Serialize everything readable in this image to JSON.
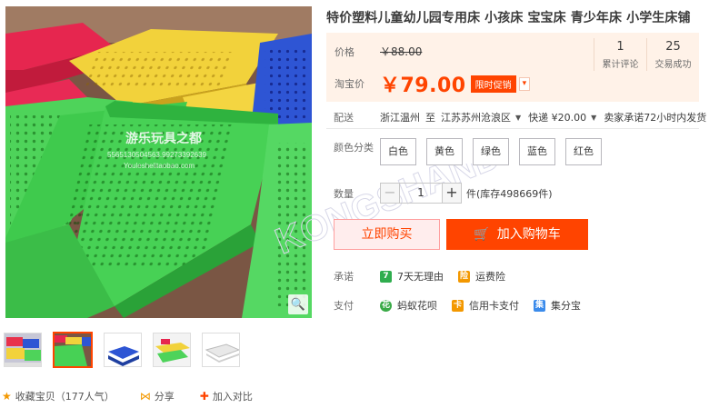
{
  "product": {
    "title": "特价塑料儿童幼儿园专用床 小孩床 宝宝床 青少年床 小学生床铺",
    "watermark_shop": "游乐玩具之都",
    "watermark_line2": "5565130504563.99273392639",
    "watermark_line3": "Youleshelitaobao.com",
    "watermark_brand": "KONGSHANDIS"
  },
  "price": {
    "label": "价格",
    "original": "￥88.00",
    "taobao_label": "淘宝价",
    "current": "￥79.00",
    "promo_tag": "限时促销",
    "promo_arrow": "▾"
  },
  "stats": [
    {
      "num": "1",
      "caption": "累计评论"
    },
    {
      "num": "25",
      "caption": "交易成功"
    }
  ],
  "shipping": {
    "label": "配送",
    "from": "浙江温州",
    "to_word": "至",
    "to": "江苏苏州沧浪区",
    "method": "快递 ¥20.00",
    "promise": "卖家承诺72小时内发货"
  },
  "colors": {
    "label": "颜色分类",
    "options": [
      "白色",
      "黄色",
      "绿色",
      "蓝色",
      "红色"
    ]
  },
  "quantity": {
    "label": "数量",
    "minus": "−",
    "plus": "+",
    "value": "1",
    "stock": "件(库存498669件)"
  },
  "buttons": {
    "buy_now": "立即购买",
    "add_cart": "加入购物车"
  },
  "promise": {
    "label": "承诺",
    "items": [
      {
        "icon": "7",
        "text": "7天无理由",
        "color": "#2fad4e"
      },
      {
        "icon": "险",
        "text": "运费险",
        "color": "#f39800"
      }
    ]
  },
  "payment": {
    "label": "支付",
    "items": [
      {
        "icon": "花",
        "text": "蚂蚁花呗",
        "color": "#3aaa47"
      },
      {
        "icon": "卡",
        "text": "信用卡支付",
        "color": "#f39800"
      },
      {
        "icon": "集",
        "text": "集分宝",
        "color": "#3b8beb"
      }
    ]
  },
  "actions": {
    "favorite": "收藏宝贝（177人气）",
    "share": "分享",
    "compare": "加入对比"
  },
  "colors_theme": {
    "accent": "#ff4400",
    "price_bg": "#fff2e8"
  }
}
